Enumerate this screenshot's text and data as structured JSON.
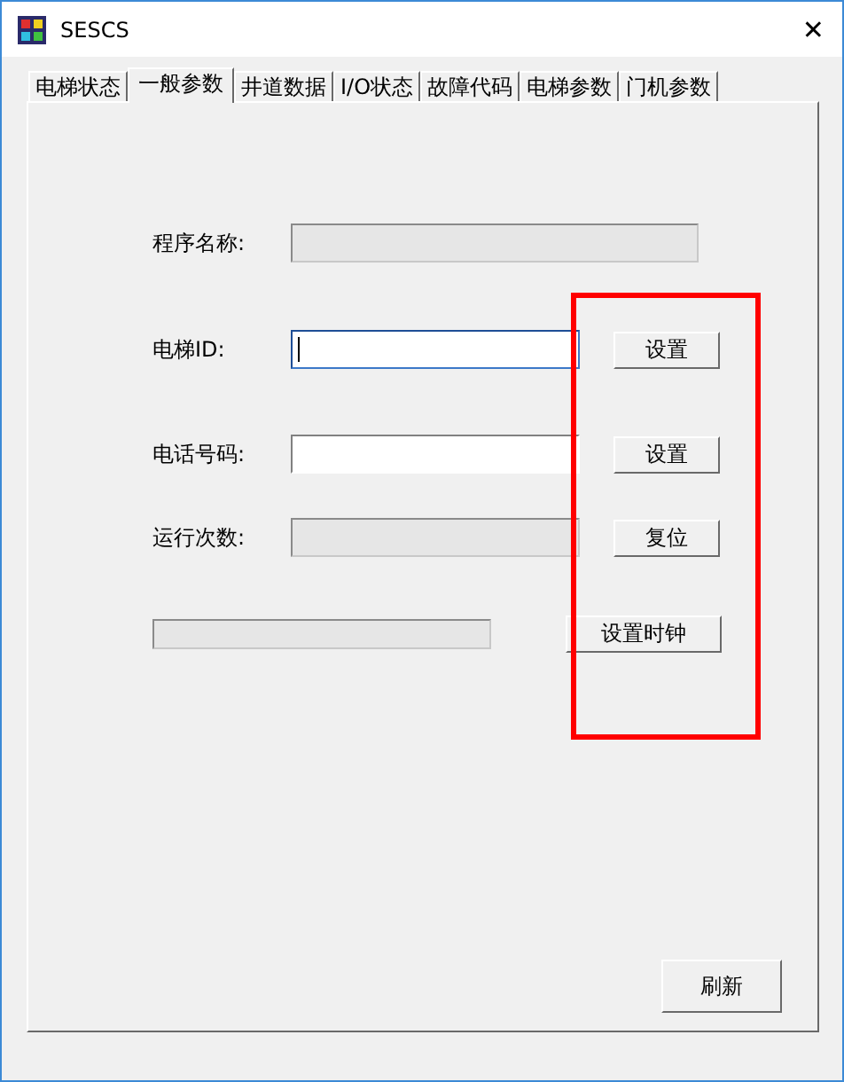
{
  "window": {
    "title": "SESCS",
    "close_glyph": "✕"
  },
  "tabs": [
    {
      "label": "电梯状态",
      "selected": false
    },
    {
      "label": "一般参数",
      "selected": true
    },
    {
      "label": "井道数据",
      "selected": false
    },
    {
      "label": "I/O状态",
      "selected": false
    },
    {
      "label": "故障代码",
      "selected": false
    },
    {
      "label": "电梯参数",
      "selected": false
    },
    {
      "label": "门机参数",
      "selected": false
    }
  ],
  "rows": [
    {
      "kind": "wide",
      "label": "程序名称:",
      "field": {
        "disabled": true
      }
    },
    {
      "kind": "standard",
      "label": "电梯ID:",
      "field": {
        "disabled": false,
        "focused": true
      },
      "button": "设置"
    },
    {
      "kind": "standard",
      "label": "电话号码:",
      "field": {
        "disabled": false,
        "focused": false
      },
      "button": "设置"
    },
    {
      "kind": "standard",
      "label": "运行次数:",
      "field": {
        "disabled": true
      },
      "button": "复位"
    },
    {
      "kind": "status",
      "field": {
        "disabled": true
      },
      "button": "设置时钟"
    }
  ],
  "refresh_button": "刷新"
}
